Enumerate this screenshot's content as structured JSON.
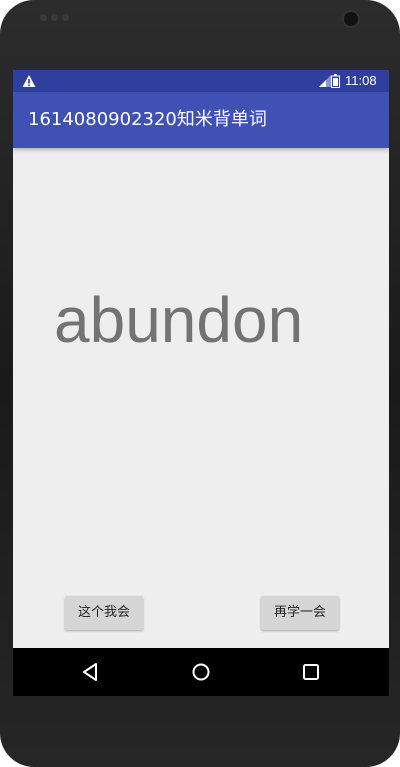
{
  "status_bar": {
    "time": "11:08",
    "icons": [
      "warning-icon",
      "signal-icon",
      "battery-icon"
    ]
  },
  "app_bar": {
    "title": "1614080902320知米背单词"
  },
  "main": {
    "word": "abundon"
  },
  "buttons": {
    "know_label": "这个我会",
    "again_label": "再学一会"
  },
  "nav_bar": {
    "icons": [
      "back-icon",
      "home-icon",
      "recent-apps-icon"
    ]
  },
  "colors": {
    "status_bar": "#303f9f",
    "app_bar": "#3f51b5",
    "screen_background": "#eeeeee",
    "word_text": "#737373",
    "button_background": "#d6d6d6"
  }
}
